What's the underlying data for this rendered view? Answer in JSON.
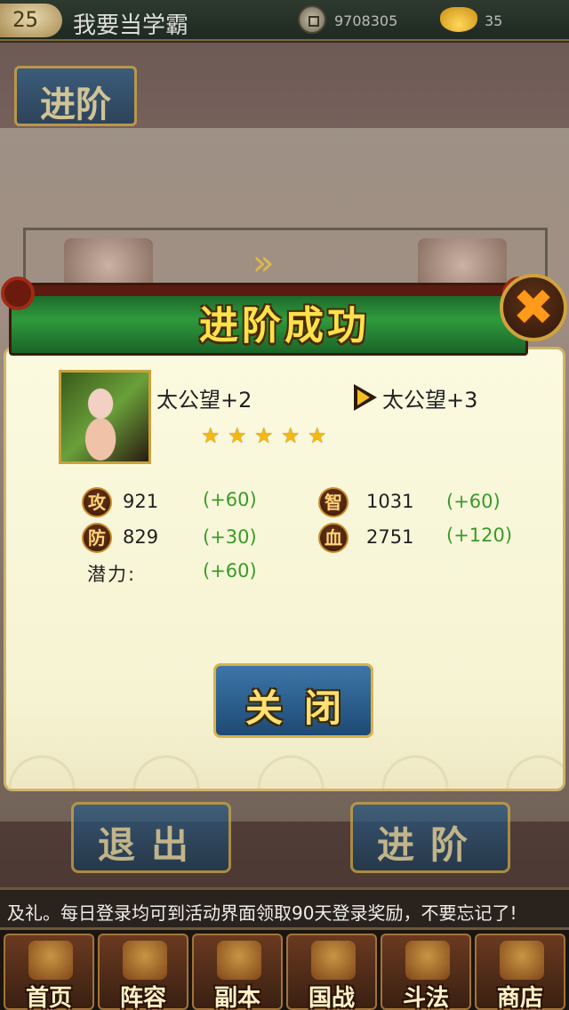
{
  "status_bar": {
    "level": "25",
    "player_name": "我要当学霸",
    "coins": "9708305",
    "gold": "35",
    "coin_icon": "copper-coin-icon",
    "gold_icon": "gold-ingot-icon"
  },
  "background": {
    "tab_label": "进阶",
    "arrows": "»",
    "exit_button": "退出",
    "advance_button": "进阶"
  },
  "dialog": {
    "title": "进阶成功",
    "close_icon": "✖",
    "hero_name_before": "太公望+2",
    "hero_name_after": "太公望+3",
    "star_count": 5,
    "stats": [
      {
        "icon_text": "攻",
        "value": "921",
        "gain": "(+60)"
      },
      {
        "icon_text": "智",
        "value": "1031",
        "gain": "(+60)"
      },
      {
        "icon_text": "防",
        "value": "829",
        "gain": "(+30)"
      },
      {
        "icon_text": "血",
        "value": "2751",
        "gain": "(+120)"
      }
    ],
    "potential_label": "潜力:",
    "potential_gain": "(+60)",
    "close_button": "关闭"
  },
  "ticker": {
    "text": "及礼。每日登录均可到活动界面领取90天登录奖励，不要忘记了!"
  },
  "nav": {
    "items": [
      {
        "label": "首页",
        "icon": "home-icon"
      },
      {
        "label": "阵容",
        "icon": "lineup-icon"
      },
      {
        "label": "副本",
        "icon": "dungeon-icon"
      },
      {
        "label": "国战",
        "icon": "war-icon"
      },
      {
        "label": "斗法",
        "icon": "duel-icon"
      },
      {
        "label": "商店",
        "icon": "shop-icon"
      }
    ]
  },
  "colors": {
    "title_gold": "#ffe24a",
    "gain_green": "#3a9a2a",
    "button_blue": "#2e5f8e",
    "banner_green": "#2f9a3c"
  }
}
